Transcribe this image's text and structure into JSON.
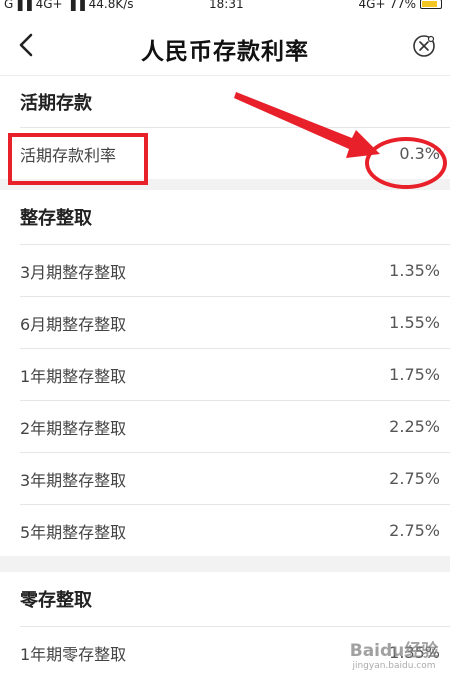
{
  "status_bar": {
    "left": "G▐▐ 4G+ ▐▐ 44.8K/s",
    "time": "18:31",
    "right": "4G+ 77%"
  },
  "header": {
    "title": "人民币存款利率"
  },
  "sections": {
    "demand": {
      "title": "活期存款",
      "rows": [
        {
          "label": "活期存款利率",
          "value": "0.3%"
        }
      ]
    },
    "fixed": {
      "title": "整存整取",
      "rows": [
        {
          "label": "3月期整存整取",
          "value": "1.35%"
        },
        {
          "label": "6月期整存整取",
          "value": "1.55%"
        },
        {
          "label": "1年期整存整取",
          "value": "1.75%"
        },
        {
          "label": "2年期整存整取",
          "value": "2.25%"
        },
        {
          "label": "3年期整存整取",
          "value": "2.75%"
        },
        {
          "label": "5年期整存整取",
          "value": "2.75%"
        }
      ]
    },
    "lump": {
      "title": "零存整取",
      "rows": [
        {
          "label": "1年期零存整取",
          "value": "1.35%"
        }
      ]
    }
  },
  "watermark": {
    "main": "Baidu经验",
    "sub": "jingyan.baidu.com"
  },
  "colors": {
    "annotation": "#e8202a",
    "battery": "#f3c623"
  }
}
